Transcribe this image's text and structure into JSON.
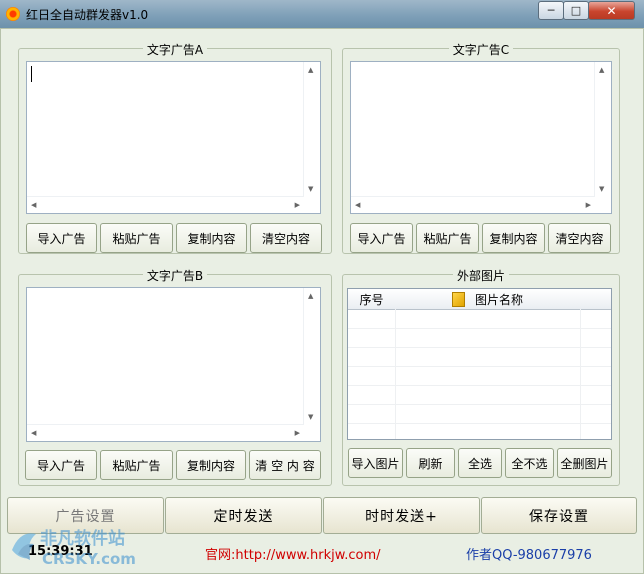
{
  "window": {
    "title": "红日全自动群发器v1.0",
    "min_glyph": "─",
    "max_glyph": "□",
    "close_glyph": "✕"
  },
  "panels": {
    "a": {
      "title": "文字广告A",
      "buttons": [
        "导入广告",
        "粘贴广告",
        "复制内容",
        "清空内容"
      ]
    },
    "b": {
      "title": "文字广告B",
      "buttons": [
        "导入广告",
        "粘贴广告",
        "复制内容",
        "清 空 内 容"
      ]
    },
    "c": {
      "title": "文字广告C",
      "buttons": [
        "导入广告",
        "粘贴广告",
        "复制内容",
        "清空内容"
      ]
    },
    "images": {
      "title": "外部图片",
      "columns": [
        "序号",
        "图片名称"
      ],
      "buttons": [
        "导入图片",
        "刷新",
        "全选",
        "全不选",
        "全删图片"
      ]
    }
  },
  "bottom_bar": {
    "buttons": [
      "广告设置",
      "定时发送",
      "时时发送+",
      "保存设置"
    ]
  },
  "status": {
    "time": "15:39:31",
    "site": "官网:http://www.hrkjw.com/",
    "author": "作者QQ-980677976"
  },
  "watermark": {
    "text_cn": "非凡软件站",
    "text_en": "CRSKY.com"
  },
  "colors": {
    "site_red": "#d00000",
    "author_blue": "#1a3fa8",
    "window_bg": "#e9efe4"
  }
}
